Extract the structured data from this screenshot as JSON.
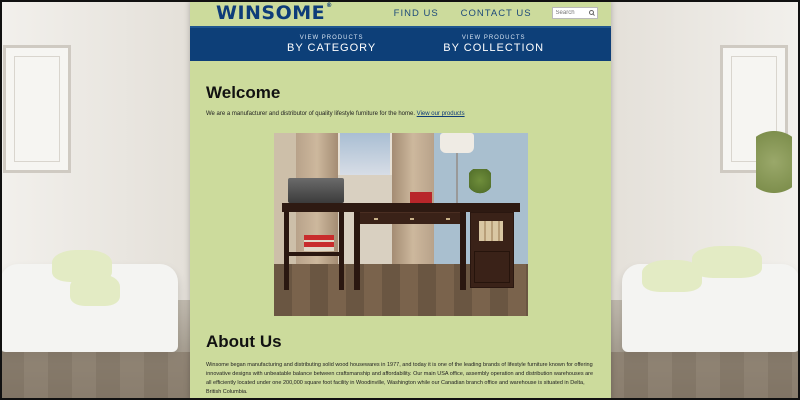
{
  "header": {
    "logo_text": "WINSOME",
    "logo_mark": "®",
    "nav": [
      {
        "label": "FIND US"
      },
      {
        "label": "CONTACT US"
      }
    ],
    "search": {
      "placeholder": "Search"
    }
  },
  "category_bar": {
    "items": [
      {
        "small": "VIEW PRODUCTS",
        "big": "BY CATEGORY"
      },
      {
        "small": "VIEW PRODUCTS",
        "big": "BY COLLECTION"
      }
    ]
  },
  "main": {
    "welcome_title": "Welcome",
    "intro_text": "We are a manufacturer and distributor of quality lifestyle furniture for the home.",
    "intro_link": "View our products",
    "about_title": "About Us",
    "about_text": "Winsome began manufacturing and distributing solid wood housewares in 1977, and today it is one of the leading brands of lifestyle furniture known for offering innovative designs with unbeatable balance between craftsmanship and affordability. Our main USA office, assembly operation and distribution warehouses are all efficiently located under one 200,000 square foot facility in Woodinville, Washington while our Canadian branch office and warehouse is situated in Delta, British Columbia."
  },
  "colors": {
    "page_bg": "#ccdb9c",
    "nav_bar": "#0d3f78",
    "logo": "#0e3c79"
  },
  "icons": {
    "search": "search-icon"
  }
}
